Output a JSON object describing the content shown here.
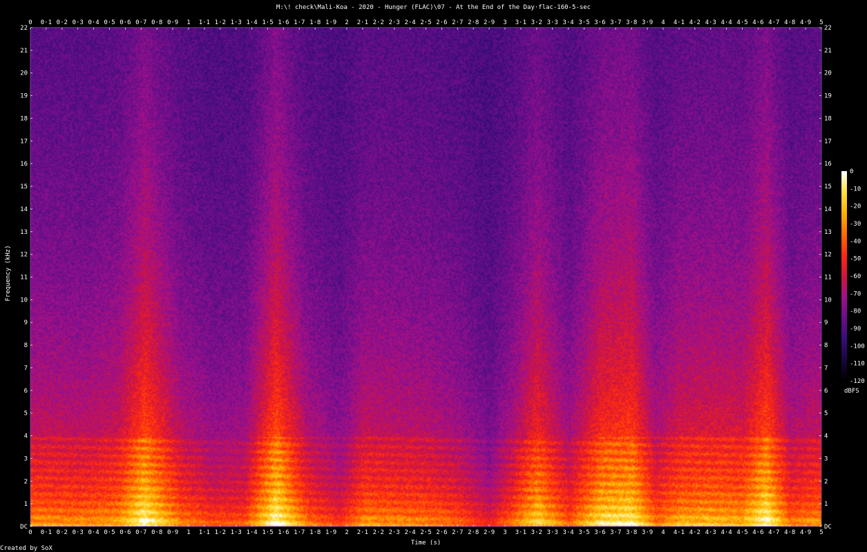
{
  "chart_data": {
    "type": "heatmap",
    "title": "M:\\! check\\Mali-Koa - 2020 - Hunger (FLAC)\\07 - At the End of the Day·flac-160-5-sec",
    "xlabel": "Time (s)",
    "ylabel": "Frequency (kHz)",
    "credit": "Created by SoX",
    "colorbar_label": "dBFS",
    "xlim": [
      0,
      5
    ],
    "ylim": [
      0,
      22
    ],
    "zlim": [
      -120,
      0
    ],
    "x_ticks": [
      "0",
      "0·1",
      "0·2",
      "0·3",
      "0·4",
      "0·5",
      "0·6",
      "0·7",
      "0·8",
      "0·9",
      "1",
      "1·1",
      "1·2",
      "1·3",
      "1·4",
      "1·5",
      "1·6",
      "1·7",
      "1·8",
      "1·9",
      "2",
      "2·1",
      "2·2",
      "2·3",
      "2·4",
      "2·5",
      "2·6",
      "2·7",
      "2·8",
      "2·9",
      "3",
      "3·1",
      "3·2",
      "3·3",
      "3·4",
      "3·5",
      "3·6",
      "3·7",
      "3·8",
      "3·9",
      "4",
      "4·1",
      "4·2",
      "4·3",
      "4·4",
      "4·5",
      "4·6",
      "4·7",
      "4·8",
      "4·9",
      "5"
    ],
    "y_ticks": [
      "DC",
      "1",
      "2",
      "3",
      "4",
      "5",
      "6",
      "7",
      "8",
      "9",
      "10",
      "11",
      "12",
      "13",
      "14",
      "15",
      "16",
      "17",
      "18",
      "19",
      "20",
      "21",
      "22"
    ],
    "colorbar_ticks": [
      "0",
      "-10",
      "-20",
      "-30",
      "-40",
      "-50",
      "-60",
      "-70",
      "-80",
      "-90",
      "-100",
      "-110",
      "-120"
    ],
    "colormap": [
      "#000000",
      "#1a0640",
      "#3a0c7a",
      "#6a0f8a",
      "#a0108a",
      "#d01540",
      "#ff2a10",
      "#ff6a00",
      "#ffb000",
      "#ffe040",
      "#ffffff"
    ],
    "series": [
      {
        "time": [
          0.05,
          0.35,
          0.55,
          0.72,
          0.95,
          1.15,
          1.35,
          1.55,
          1.75,
          1.95,
          2.1,
          2.3,
          2.5,
          2.7,
          2.9,
          3.05,
          3.2,
          3.4,
          3.6,
          3.8,
          3.95,
          4.1,
          4.3,
          4.5,
          4.65,
          4.8,
          4.95
        ],
        "energy": [
          0.62,
          0.6,
          0.66,
          0.95,
          0.58,
          0.45,
          0.48,
          0.97,
          0.55,
          0.4,
          0.62,
          0.6,
          0.58,
          0.5,
          0.32,
          0.55,
          0.82,
          0.5,
          0.85,
          0.9,
          0.55,
          0.7,
          0.72,
          0.7,
          0.95,
          0.55,
          0.62
        ]
      }
    ]
  }
}
